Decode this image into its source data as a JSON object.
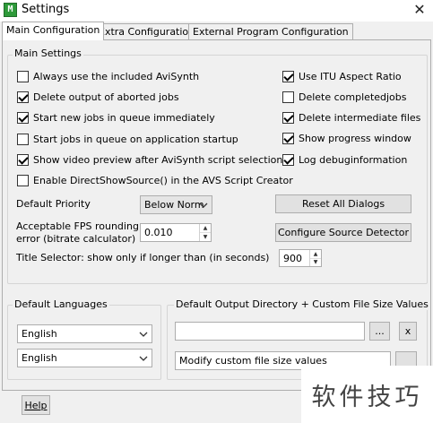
{
  "window": {
    "title": "Settings",
    "app_icon_glyph": "M",
    "close_glyph": "✕"
  },
  "tabs": [
    {
      "label": "Main Configuration",
      "active": true
    },
    {
      "label": "Extra Configuration",
      "active": false
    },
    {
      "label": "External Program Configuration",
      "active": false
    }
  ],
  "main_settings": {
    "title": "Main Settings",
    "left_checkboxes": [
      {
        "label": "Always use the included AviSynth",
        "checked": false
      },
      {
        "label": "Delete output of aborted jobs",
        "checked": true
      },
      {
        "label": "Start new jobs in queue immediately",
        "checked": true
      },
      {
        "label": "Start jobs in queue on application startup",
        "checked": false
      },
      {
        "label": "Show video preview after AviSynth script selection",
        "checked": true
      },
      {
        "label": "Enable DirectShowSource() in the AVS Script Creator",
        "checked": false
      }
    ],
    "right_checkboxes": [
      {
        "label": "Use ITU Aspect Ratio",
        "checked": true
      },
      {
        "label": "Delete completedjobs",
        "checked": false
      },
      {
        "label": "Delete intermediate files",
        "checked": true
      },
      {
        "label": "Show progress window",
        "checked": true
      },
      {
        "label": "Log debuginformation",
        "checked": true
      }
    ],
    "priority_label": "Default Priority",
    "priority_value": "Below Norm",
    "fps_label_line1": "Acceptable FPS rounding",
    "fps_label_line2": "error (bitrate calculator)",
    "fps_value": "0.010",
    "title_selector_label": "Title Selector:  show only if longer than (in seconds)",
    "title_selector_value": "900",
    "reset_button": "Reset All Dialogs",
    "configure_button": "Configure Source Detector"
  },
  "default_languages": {
    "title": "Default Languages",
    "language_1": "English",
    "language_2": "English"
  },
  "output_directory": {
    "title": "Default Output Directory + Custom File Size Values",
    "path_value": "",
    "browse_label": "...",
    "clear_label": "x",
    "custom_size_value": "Modify custom file size values"
  },
  "footer": {
    "help_button": "Help"
  },
  "watermark": {
    "text": "软件技巧"
  }
}
